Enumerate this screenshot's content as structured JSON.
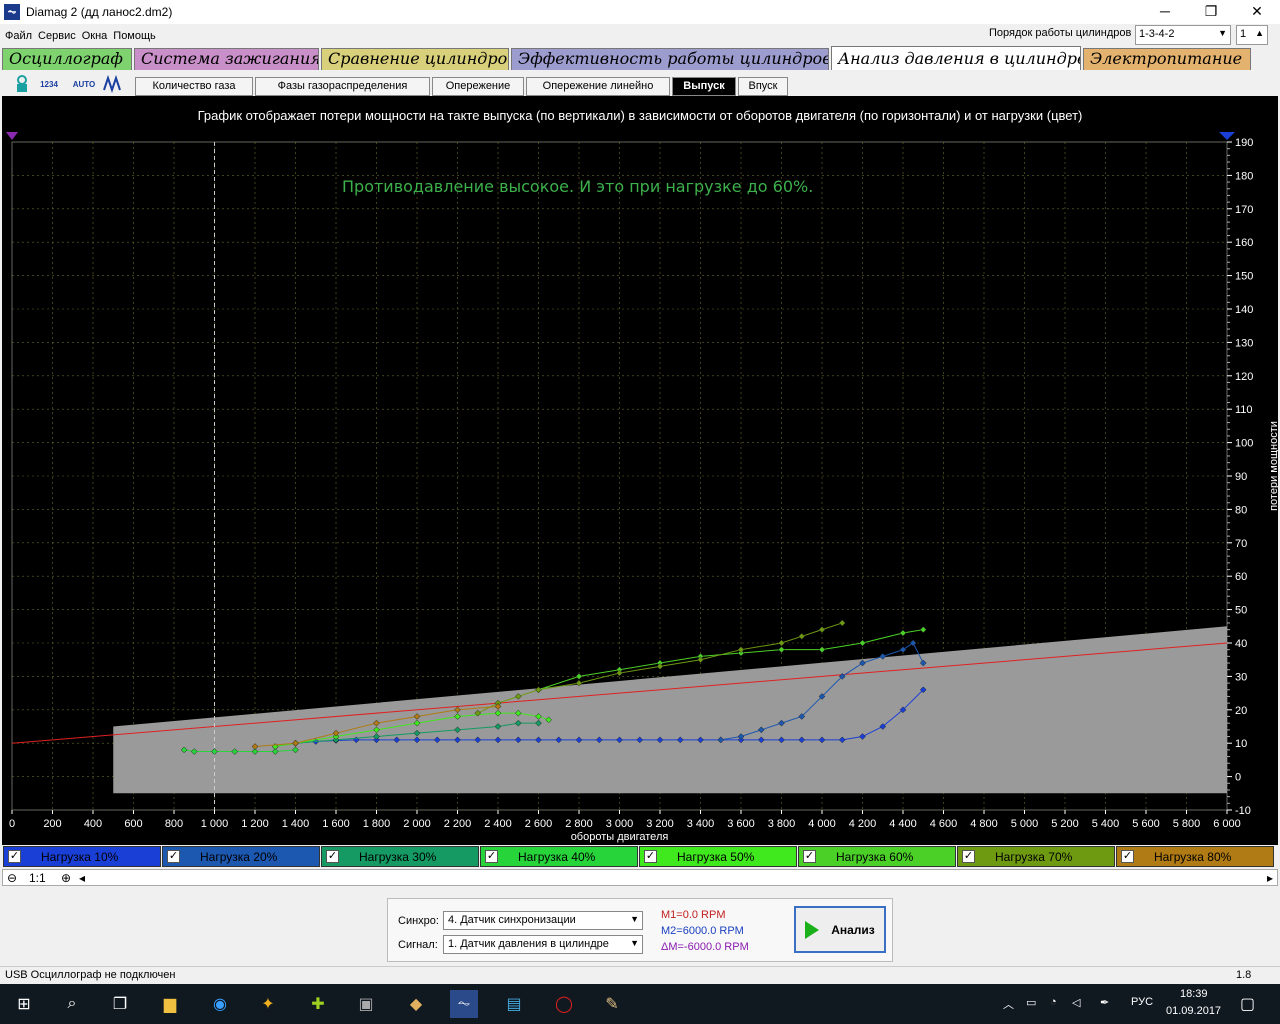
{
  "window": {
    "title": "Diamag 2 (дд ланос2.dm2)",
    "min": "─",
    "max": "❐",
    "close": "✕"
  },
  "menu": [
    "Файл",
    "Сервис",
    "Окна",
    "Помощь"
  ],
  "cylinder_order": {
    "label": "Порядок работы цилиндров",
    "value": "1-3-4-2",
    "count": "1"
  },
  "main_tabs": [
    {
      "label": "Осциллограф",
      "color": "#7fd36f"
    },
    {
      "label": "Система зажигания",
      "color": "#c98fc9"
    },
    {
      "label": "Сравнение цилиндров",
      "color": "#d8d07a"
    },
    {
      "label": "Эффективность работы цилиндров",
      "color": "#9c9ccf"
    },
    {
      "label": "Анализ давления в цилиндре",
      "color": "#ffffff"
    },
    {
      "label": "Электропитание",
      "color": "#e3b26e"
    }
  ],
  "toolbar_icons": [
    "cylinder-icon",
    "numbering-icon",
    "auto-scale-icon",
    "peak-icon"
  ],
  "toolbar_text": {
    "num": "1234",
    "auto": "AUTO"
  },
  "sub_tabs": [
    "Количество газа",
    "Фазы газораспределения",
    "Опережение",
    "Опережение линейно",
    "Выпуск",
    "Впуск"
  ],
  "sub_tab_active": "Выпуск",
  "chart_caption": "График отображает потери мощности на такте выпуска (по вертикали) в зависимости от оборотов двигателя (по горизонтали) и от нагрузки (цвет)",
  "annotation": "Противодавление высокое. И это при нагрузке до 60%.",
  "loads": [
    {
      "label": "Нагрузка 10%",
      "color": "#1a3fd6"
    },
    {
      "label": "Нагрузка 20%",
      "color": "#1c57b0"
    },
    {
      "label": "Нагрузка 30%",
      "color": "#149a62"
    },
    {
      "label": "Нагрузка 40%",
      "color": "#27d43a"
    },
    {
      "label": "Нагрузка 50%",
      "color": "#40e81e"
    },
    {
      "label": "Нагрузка 60%",
      "color": "#4bd028"
    },
    {
      "label": "Нагрузка 70%",
      "color": "#6e9a12"
    },
    {
      "label": "Нагрузка 80%",
      "color": "#b07a14"
    }
  ],
  "zoom_label": "1:1",
  "sync": {
    "label": "Синхро:",
    "value": "4. Датчик синхронизации"
  },
  "signal": {
    "label": "Сигнал:",
    "value": "1. Датчик давления в цилиндре"
  },
  "markers": {
    "m1": "M1=0.0 RPM",
    "m2": "M2=6000.0 RPM",
    "dm": "ΔM=-6000.0 RPM"
  },
  "analyze_label": "Анализ",
  "status": {
    "left": "USB Осциллограф не подключен",
    "right": "1.8"
  },
  "tray": {
    "lang": "РУС",
    "time": "18:39",
    "date": "01.09.2017"
  },
  "chart_data": {
    "type": "scatter",
    "xlabel": "обороты двигателя",
    "ylabel": "потери мощности",
    "xlim": [
      0,
      6000
    ],
    "ylim": [
      -10,
      190
    ],
    "xticks": [
      0,
      200,
      400,
      600,
      800,
      1000,
      1200,
      1400,
      1600,
      1800,
      2000,
      2200,
      2400,
      2600,
      2800,
      3000,
      3200,
      3400,
      3600,
      3800,
      4000,
      4200,
      4400,
      4600,
      4800,
      5000,
      5200,
      5400,
      5600,
      5800,
      6000
    ],
    "xtick_labels": [
      "0",
      "200",
      "400",
      "600",
      "800",
      "1 000",
      "1 200",
      "1 400",
      "1 600",
      "1 800",
      "2 000",
      "2 200",
      "2 400",
      "2 600",
      "2 800",
      "3 000",
      "3 200",
      "3 400",
      "3 600",
      "3 800",
      "4 000",
      "4 200",
      "4 400",
      "4 600",
      "4 800",
      "5 000",
      "5 200",
      "5 400",
      "5 600",
      "5 800",
      "6 000"
    ],
    "yticks": [
      -10,
      0,
      10,
      20,
      30,
      40,
      50,
      60,
      70,
      80,
      90,
      100,
      110,
      120,
      130,
      140,
      150,
      160,
      170,
      180,
      190
    ],
    "grid": true,
    "marker_line_x": 1000,
    "reference_band": {
      "x": [
        500,
        6000
      ],
      "y_bottom": -5,
      "y_top_start": 15,
      "y_top_end": 45,
      "color": "#9a9a9a"
    },
    "reference_line": {
      "x": [
        0,
        6000
      ],
      "y": [
        10,
        40
      ],
      "color": "#e02020"
    },
    "series": [
      {
        "name": "Нагрузка 10%",
        "color": "#1a3fd6",
        "x": [
          1400,
          1500,
          1600,
          1700,
          1800,
          1900,
          2000,
          2100,
          2200,
          2300,
          2400,
          2500,
          2600,
          2700,
          2800,
          2900,
          3000,
          3100,
          3200,
          3300,
          3400,
          3500,
          3600,
          3700,
          3800,
          3900,
          4000,
          4100,
          4200,
          4300,
          4400,
          4500
        ],
        "y": [
          10,
          10.5,
          10.8,
          11,
          11,
          11,
          11,
          11,
          11,
          11,
          11,
          11,
          11,
          11,
          11,
          11,
          11,
          11,
          11,
          11,
          11,
          11,
          11,
          11,
          11,
          11,
          11,
          11,
          12,
          15,
          20,
          26
        ]
      },
      {
        "name": "Нагрузка 20%",
        "color": "#1c57b0",
        "x": [
          3500,
          3600,
          3700,
          3800,
          3900,
          4000,
          4100,
          4200,
          4300,
          4400,
          4450,
          4500
        ],
        "y": [
          11,
          12,
          14,
          16,
          18,
          24,
          30,
          34,
          36,
          38,
          40,
          34
        ]
      },
      {
        "name": "Нагрузка 30%",
        "color": "#149a62",
        "x": [
          1300,
          1400,
          1600,
          1800,
          2000,
          2200,
          2400,
          2500,
          2600
        ],
        "y": [
          9,
          10,
          11,
          12,
          13,
          14,
          15,
          16,
          16
        ]
      },
      {
        "name": "Нагрузка 40%",
        "color": "#27d43a",
        "x": [
          850,
          900,
          1000,
          1100,
          1200,
          1300,
          1400
        ],
        "y": [
          8,
          7.5,
          7.5,
          7.5,
          7.5,
          7.5,
          8
        ]
      },
      {
        "name": "Нагрузка 50%",
        "color": "#40e81e",
        "x": [
          1300,
          1400,
          1600,
          1800,
          2000,
          2200,
          2400,
          2500,
          2600,
          2650
        ],
        "y": [
          9,
          10,
          12,
          14,
          16,
          18,
          19,
          19,
          18,
          17
        ]
      },
      {
        "name": "Нагрузка 60%",
        "color": "#4bd028",
        "x": [
          2600,
          2800,
          3000,
          3200,
          3400,
          3600,
          3800,
          4000,
          4200,
          4400,
          4500
        ],
        "y": [
          26,
          30,
          32,
          34,
          36,
          37,
          38,
          38,
          40,
          43,
          44
        ]
      },
      {
        "name": "Нагрузка 70%",
        "color": "#6e9a12",
        "x": [
          2300,
          2400,
          2500,
          2600,
          2800,
          3000,
          3200,
          3400,
          3600,
          3800,
          3900,
          4000,
          4100
        ],
        "y": [
          19,
          22,
          24,
          26,
          28,
          31,
          33,
          35,
          38,
          40,
          42,
          44,
          46
        ]
      },
      {
        "name": "Нагрузка 80%",
        "color": "#b07a14",
        "x": [
          1200,
          1400,
          1600,
          1800,
          2000,
          2200,
          2400
        ],
        "y": [
          9,
          10,
          13,
          16,
          18,
          20,
          21
        ]
      }
    ]
  }
}
